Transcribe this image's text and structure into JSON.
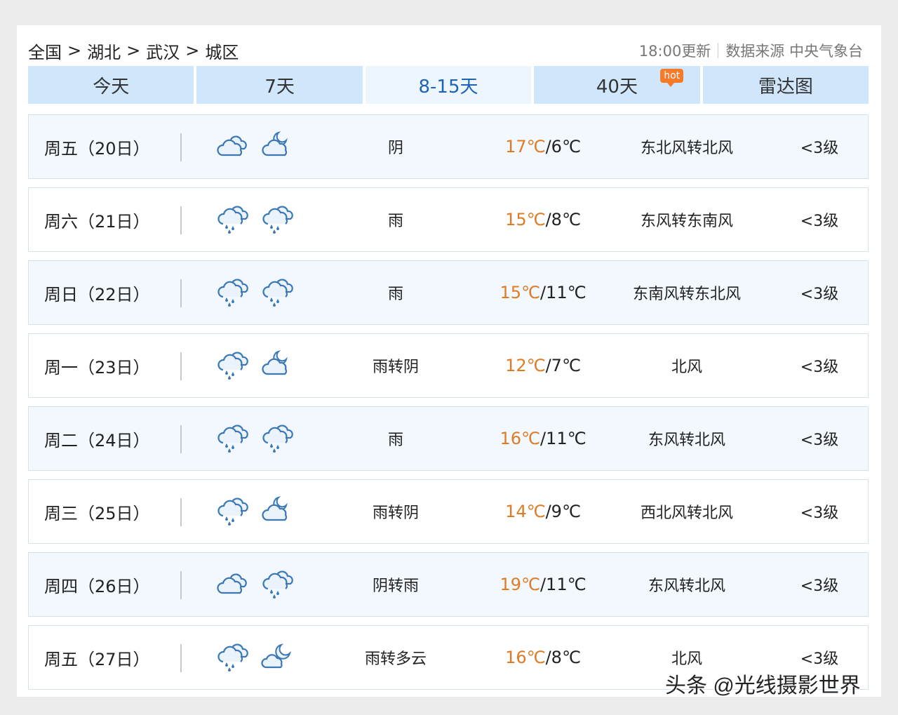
{
  "breadcrumb": {
    "items": [
      "全国",
      "湖北",
      "武汉",
      "城区"
    ],
    "separator": ">"
  },
  "update_info": {
    "time": "18:00更新",
    "source": "数据来源 中央气象台"
  },
  "tabs": [
    {
      "label": "今天",
      "active": false
    },
    {
      "label": "7天",
      "active": false
    },
    {
      "label": "8-15天",
      "active": true
    },
    {
      "label": "40天",
      "active": false,
      "badge": "hot"
    },
    {
      "label": "雷达图",
      "active": false
    }
  ],
  "forecast": [
    {
      "date": "周五（20日）",
      "icons": [
        "cloudy-icon",
        "cloudy-night-icon"
      ],
      "condition": "阴",
      "high": "17℃",
      "low": "6℃",
      "wind": "东北风转北风",
      "level": "<3级"
    },
    {
      "date": "周六（21日）",
      "icons": [
        "rain-icon",
        "rain-icon"
      ],
      "condition": "雨",
      "high": "15℃",
      "low": "8℃",
      "wind": "东风转东南风",
      "level": "<3级"
    },
    {
      "date": "周日（22日）",
      "icons": [
        "rain-icon",
        "rain-icon"
      ],
      "condition": "雨",
      "high": "15℃",
      "low": "11℃",
      "wind": "东南风转东北风",
      "level": "<3级"
    },
    {
      "date": "周一（23日）",
      "icons": [
        "rain-icon",
        "cloudy-night-icon"
      ],
      "condition": "雨转阴",
      "high": "12℃",
      "low": "7℃",
      "wind": "北风",
      "level": "<3级"
    },
    {
      "date": "周二（24日）",
      "icons": [
        "rain-icon",
        "rain-icon"
      ],
      "condition": "雨",
      "high": "16℃",
      "low": "11℃",
      "wind": "东风转北风",
      "level": "<3级"
    },
    {
      "date": "周三（25日）",
      "icons": [
        "rain-icon",
        "cloudy-night-icon"
      ],
      "condition": "雨转阴",
      "high": "14℃",
      "low": "9℃",
      "wind": "西北风转北风",
      "level": "<3级"
    },
    {
      "date": "周四（26日）",
      "icons": [
        "cloudy-icon",
        "rain-icon"
      ],
      "condition": "阴转雨",
      "high": "19℃",
      "low": "11℃",
      "wind": "东风转北风",
      "level": "<3级"
    },
    {
      "date": "周五（27日）",
      "icons": [
        "rain-icon",
        "partly-cloudy-night-icon"
      ],
      "condition": "雨转多云",
      "high": "16℃",
      "low": "8℃",
      "wind": "北风",
      "level": "<3级"
    }
  ],
  "watermark": "头条 @光线摄影世界",
  "colors": {
    "tab_bg": "#cfe6fb",
    "tab_active_bg": "#eef6fd",
    "tab_active_text": "#1e63b8",
    "high_temp": "#e07b25",
    "hot_badge": "#f57b2a",
    "icon_stroke": "#3b78b4"
  }
}
